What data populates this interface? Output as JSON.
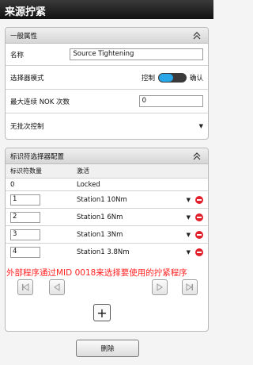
{
  "title": "来源拧紧",
  "general_panel": {
    "header": "一般属性",
    "name_label": "名称",
    "name_value": "Source Tightening",
    "selector_mode_label": "选择器模式",
    "mode_left": "控制",
    "mode_right": "确认",
    "max_nok_label": "最大连续 NOK 次数",
    "max_nok_value": "0",
    "no_batch_label": "无批次控制"
  },
  "identifier_panel": {
    "header": "标识符选择器配置",
    "col_count": "标识符数量",
    "col_activate": "激活",
    "locked_row": {
      "count": "0",
      "value": "Locked"
    },
    "rows": [
      {
        "count": "1",
        "value": "Station1 10Nm"
      },
      {
        "count": "2",
        "value": "Station1 6Nm"
      },
      {
        "count": "3",
        "value": "Station1 3Nm"
      },
      {
        "count": "4",
        "value": "Station1 3.8Nm"
      }
    ]
  },
  "annotation": "外部程序通过MID 0018来选择要使用的拧紧程序",
  "delete_label": "删除",
  "colors": {
    "accent": "#29a7e8",
    "remove": "#e2202c",
    "annotation": "#ff2222"
  },
  "icons": [
    "collapse-up-icon",
    "remove-icon",
    "first-page-icon",
    "prev-page-icon",
    "next-page-icon",
    "last-page-icon",
    "plus-icon",
    "dropdown-icon"
  ]
}
